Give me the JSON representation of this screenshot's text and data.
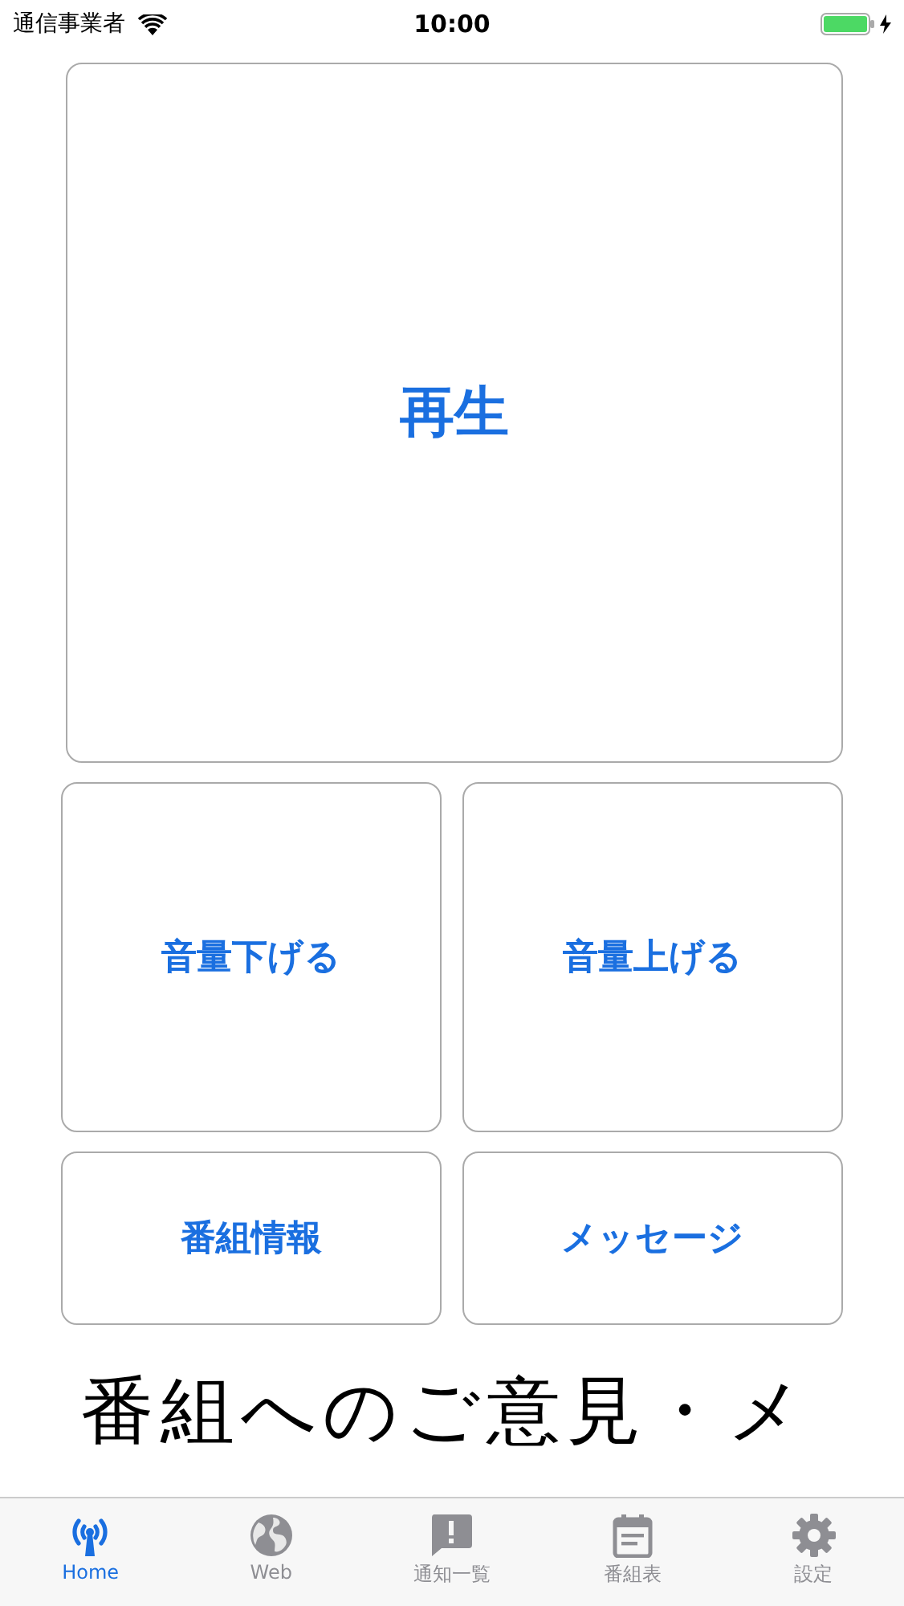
{
  "status_bar": {
    "carrier": "通信事業者",
    "time": "10:00"
  },
  "play_button": {
    "label": "再生"
  },
  "buttons": [
    {
      "label": "音量下げる"
    },
    {
      "label": "音量上げる"
    },
    {
      "label": "番組情報"
    },
    {
      "label": "メッセージ"
    }
  ],
  "ticker": {
    "text": "番組へのご意見・メ"
  },
  "tabs": [
    {
      "label": "Home",
      "kind": "antenna",
      "selected": true
    },
    {
      "label": "Web",
      "kind": "globe",
      "selected": false
    },
    {
      "label": "通知一覧",
      "kind": "alert",
      "selected": false
    },
    {
      "label": "番組表",
      "kind": "calendar",
      "selected": false
    },
    {
      "label": "設定",
      "kind": "gear",
      "selected": false
    }
  ]
}
